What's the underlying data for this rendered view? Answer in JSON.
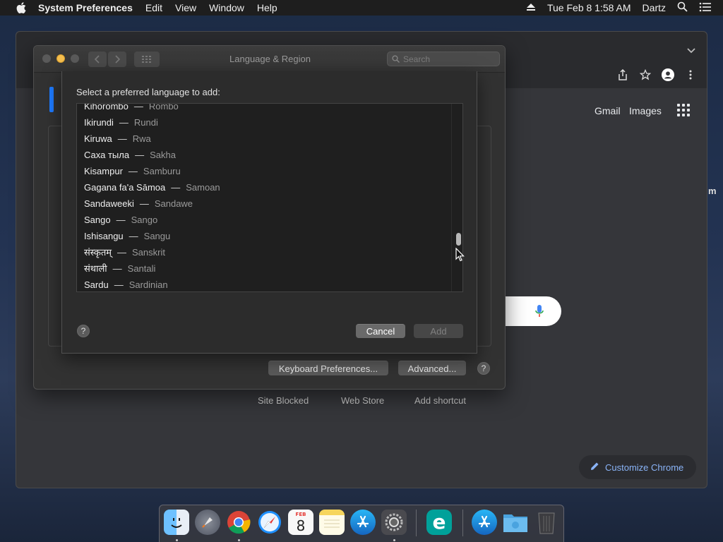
{
  "menubar": {
    "app_name": "System Preferences",
    "items": [
      "Edit",
      "View",
      "Window",
      "Help"
    ],
    "datetime": "Tue Feb 8  1:58 AM",
    "user": "Dartz"
  },
  "chrome": {
    "gmail": "Gmail",
    "images": "Images",
    "shortcuts": [
      "Site Blocked",
      "Web Store",
      "Add shortcut"
    ],
    "customize": "Customize Chrome",
    "side_text": "m"
  },
  "prefs": {
    "title": "Language & Region",
    "search_placeholder": "Search",
    "keyboard_prefs": "Keyboard Preferences...",
    "advanced": "Advanced...",
    "help": "?"
  },
  "sheet": {
    "prompt": "Select a preferred language to add:",
    "languages": [
      {
        "native": "Kihorombo",
        "english": "Rombo"
      },
      {
        "native": "Ikirundi",
        "english": "Rundi"
      },
      {
        "native": "Kiruwa",
        "english": "Rwa"
      },
      {
        "native": "Саха тыла",
        "english": "Sakha"
      },
      {
        "native": "Kisampur",
        "english": "Samburu"
      },
      {
        "native": "Gagana fa'a Sāmoa",
        "english": "Samoan"
      },
      {
        "native": "Sandaweeki",
        "english": "Sandawe"
      },
      {
        "native": "Sango",
        "english": "Sango"
      },
      {
        "native": "Ishisangu",
        "english": "Sangu"
      },
      {
        "native": "संस्कृतम्",
        "english": "Sanskrit"
      },
      {
        "native": "संथाली",
        "english": "Santali"
      },
      {
        "native": "Sardu",
        "english": "Sardinian"
      }
    ],
    "separator": "—",
    "cancel": "Cancel",
    "add": "Add",
    "help": "?"
  },
  "dock": {
    "calendar_month": "FEB",
    "calendar_day": "8",
    "eset_letter": "e"
  }
}
